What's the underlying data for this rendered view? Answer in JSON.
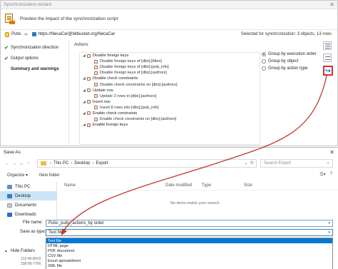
{
  "wizard": {
    "title": "Synchronization wizard",
    "subtitle": "Preview the impact of the synchronization script",
    "source_db": "Pubs",
    "arrow": "⇒",
    "target_repo": "https://NecaCar@bitbucket.org/NecaCar",
    "selected_summary": "Selected for synchronization: 3 objects, 13 rows",
    "steps": [
      {
        "label": "Synchronization direction",
        "done": true
      },
      {
        "label": "Output options",
        "done": true
      },
      {
        "label": "Summary and warnings",
        "done": false,
        "current": true
      }
    ],
    "actions_label": "Actions",
    "tree": [
      {
        "level": 1,
        "label": "Disable foreign keys"
      },
      {
        "level": 2,
        "label": "Disable foreign keys of [dbo].[titles]"
      },
      {
        "level": 2,
        "label": "Disable foreign keys of [dbo].[pub_info]"
      },
      {
        "level": 2,
        "label": "Disable foreign keys of [dbo].[authors]"
      },
      {
        "level": 1,
        "label": "Disable check constraints"
      },
      {
        "level": 2,
        "label": "Disable check constraints on [dbo].[authors]"
      },
      {
        "level": 1,
        "label": "Update row"
      },
      {
        "level": 2,
        "label": "Update 2 rows in [dbo].[authors]"
      },
      {
        "level": 1,
        "label": "Insert row"
      },
      {
        "level": 2,
        "label": "Insert 8 rows into [dbo].[pub_info]"
      },
      {
        "level": 1,
        "label": "Enable check constraints"
      },
      {
        "level": 2,
        "label": "Enable check constraints on [dbo].[authors]"
      },
      {
        "level": 1,
        "label": "Enable foreign keys"
      }
    ],
    "group_options": [
      {
        "label": "Group by execution order",
        "selected": true
      },
      {
        "label": "Group by object",
        "selected": false
      },
      {
        "label": "Group by action type",
        "selected": false
      }
    ]
  },
  "save_as": {
    "title": "Save As",
    "breadcrumb": [
      "This PC",
      "Desktop",
      "Export"
    ],
    "search_placeholder": "Search Export",
    "organize": "Organize ▾",
    "new_folder": "New folder",
    "nav_items": [
      {
        "label": "This PC",
        "icon": "pc"
      },
      {
        "label": "Desktop",
        "icon": "desk",
        "selected": true
      },
      {
        "label": "Documents",
        "icon": "doc"
      },
      {
        "label": "Downloads",
        "icon": "dl"
      }
    ],
    "columns": [
      "Name",
      "Date modified",
      "Type",
      "Size"
    ],
    "empty_message": "No items match your search.",
    "file_name_label": "File name:",
    "file_name_value": "Pubs_pubs_actions_by order",
    "save_type_label": "Save as type:",
    "save_type_value": "Text file",
    "type_options": [
      "Text file",
      "HTML page",
      "PDF document",
      "CSV file",
      "Excel spreadsheet",
      "XML file"
    ],
    "highlighted_option": 0,
    "hide_folders": "Hide Folders",
    "partial_rows": [
      "213-46-8915",
      "238-95-7766"
    ]
  },
  "colors": {
    "accent": "#0078d7",
    "annotation": "#c0392b",
    "highlight_box": "#d23030"
  }
}
